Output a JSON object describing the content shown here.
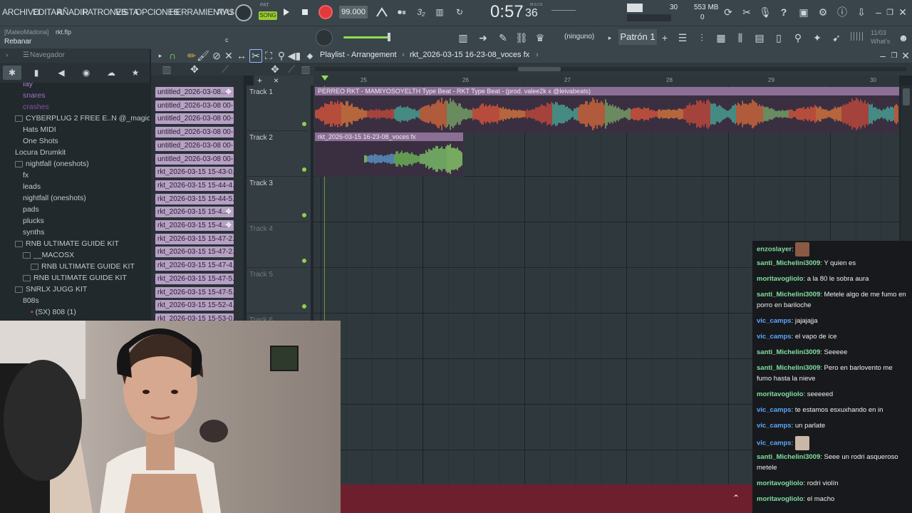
{
  "menu": [
    "ARCHIVO",
    "EDITAR",
    "AÑADIR",
    "PATRONES",
    "VISTA",
    "OPCIONES",
    "HERRAMIENTAS",
    "AYU"
  ],
  "transport": {
    "mode": "SONG",
    "pat_label": "PAT",
    "tempo": "99.000",
    "time": "0:57",
    "time_sub": "36",
    "time_unit": "M:S:CS",
    "cpu": "30",
    "ram": "553 MB",
    "voices": "0"
  },
  "project": {
    "user": "[MateoMadona]",
    "file": "rkt.flp",
    "tool_hint": "Rebanar",
    "snap": "c"
  },
  "toolbar2": {
    "channel": "(ninguno)",
    "pattern": "Patrón 1",
    "news_date": "11/03",
    "news_text": "What's"
  },
  "browser": {
    "title": "Navegador",
    "items": [
      {
        "label": "fay",
        "indent": 2,
        "folder": false,
        "color": "#b07fd0"
      },
      {
        "label": "snares",
        "indent": 2,
        "folder": false,
        "color": "#a070c8"
      },
      {
        "label": "crashes",
        "indent": 2,
        "folder": false,
        "color": "#8050a8"
      },
      {
        "label": "CYBERPLUG 2 FREE E..N @_magicalsounds",
        "indent": 1,
        "folder": true,
        "color": "#bfc8cc"
      },
      {
        "label": "Hats MIDI",
        "indent": 2,
        "folder": false,
        "color": "#bfc8cc"
      },
      {
        "label": "One Shots",
        "indent": 2,
        "folder": false,
        "color": "#bfc8cc"
      },
      {
        "label": "Locura Drumkit",
        "indent": 1,
        "folder": false,
        "color": "#bfc8cc"
      },
      {
        "label": "nightfall (oneshots)",
        "indent": 1,
        "folder": true,
        "color": "#bfc8cc"
      },
      {
        "label": "fx",
        "indent": 2,
        "folder": false,
        "color": "#bfc8cc"
      },
      {
        "label": "leads",
        "indent": 2,
        "folder": false,
        "color": "#bfc8cc"
      },
      {
        "label": "nightfall (oneshots)",
        "indent": 2,
        "folder": false,
        "color": "#bfc8cc"
      },
      {
        "label": "pads",
        "indent": 2,
        "folder": false,
        "color": "#bfc8cc"
      },
      {
        "label": "plucks",
        "indent": 2,
        "folder": false,
        "color": "#bfc8cc"
      },
      {
        "label": "synths",
        "indent": 2,
        "folder": false,
        "color": "#bfc8cc"
      },
      {
        "label": "RNB ULTIMATE GUIDE KIT",
        "indent": 1,
        "folder": true,
        "color": "#bfc8cc"
      },
      {
        "label": "__MACOSX",
        "indent": 2,
        "folder": true,
        "color": "#bfc8cc"
      },
      {
        "label": "RNB ULTIMATE GUIDE KIT",
        "indent": 3,
        "folder": true,
        "color": "#bfc8cc"
      },
      {
        "label": "RNB ULTIMATE GUIDE KIT",
        "indent": 2,
        "folder": true,
        "color": "#bfc8cc"
      },
      {
        "label": "SNRLX JUGG KIT",
        "indent": 1,
        "folder": true,
        "color": "#bfc8cc"
      },
      {
        "label": "808s",
        "indent": 2,
        "folder": false,
        "color": "#bfc8cc"
      },
      {
        "label": "(SX) 808 (1)",
        "indent": 3,
        "folder": false,
        "color": "#bfc8cc"
      }
    ]
  },
  "clips": [
    "untitled_2026-03-08...",
    "untitled_2026-03-08 00-...",
    "untitled_2026-03-08 00-...",
    "untitled_2026-03-08 00-...",
    "untitled_2026-03-08 00-...",
    "untitled_2026-03-08 00-...",
    "rkt_2026-03-15 15-43-0...",
    "rkt_2026-03-15 15-44-4...",
    "rkt_2026-03-15 15-44-5...",
    "rkt_2026-03-15 15-4...",
    "rkt_2026-03-15 15-4...",
    "rkt_2026-03-15 15-47-2...",
    "rkt_2026-03-15 15-47-2...",
    "rkt_2026-03-15 15-47-4...",
    "rkt_2026-03-15 15-47-5...",
    "rkt_2026-03-15 15-47-5...",
    "rkt_2026-03-15 15-52-4...",
    "rkt_2026-03-15 15-53-0..."
  ],
  "playlist": {
    "title": "Playlist - Arrangement",
    "breadcrumb_sep": "›",
    "current_clip": "rkt_2026-03-15 16-23-08_voces fx",
    "ruler": [
      "25",
      "26",
      "27",
      "28",
      "29",
      "30"
    ],
    "tracks": [
      "Track 1",
      "Track 2",
      "Track 3",
      "Track 4",
      "Track 5",
      "Track 6"
    ],
    "audio_clips": [
      {
        "name": "PERREO RKT - MAMIYOSOYELTH Type Beat - RKT Type Beat - (prod. valee2k x @leivabeats)",
        "track": 1
      },
      {
        "name": "rkt_2026-03-15 16-23-08_voces fx",
        "track": 2
      }
    ]
  },
  "chat": [
    {
      "user": "enzoslayer",
      "color": "#7fe0a0",
      "text": "",
      "emote": "face"
    },
    {
      "user": "santi_Michelini3009",
      "color": "#7fe0a0",
      "text": "Y quien es"
    },
    {
      "user": "moritavogliolo",
      "color": "#7fe0a0",
      "text": "a la 80 le sobra aura"
    },
    {
      "user": "santi_Michelini3009",
      "color": "#7fe0a0",
      "text": "Metele algo de me fumo en porro en bariloche"
    },
    {
      "user": "vic_camps",
      "color": "#5aa8ff",
      "text": "jajajajja"
    },
    {
      "user": "vic_camps",
      "color": "#5aa8ff",
      "text": "el vapo de ice"
    },
    {
      "user": "santi_Michelini3009",
      "color": "#7fe0a0",
      "text": "Seeeee"
    },
    {
      "user": "santi_Michelini3009",
      "color": "#7fe0a0",
      "text": "Pero en barlovento me fumo hasta la nieve"
    },
    {
      "user": "moritavogliolo",
      "color": "#7fe0a0",
      "text": "seeeeed"
    },
    {
      "user": "vic_camps",
      "color": "#5aa8ff",
      "text": "te estamos esxuxhando en in"
    },
    {
      "user": "vic_camps",
      "color": "#5aa8ff",
      "text": "un parlate"
    },
    {
      "user": "vic_camps",
      "color": "#5aa8ff",
      "text": "",
      "emote": "cat"
    },
    {
      "user": "santi_Michelini3009",
      "color": "#7fe0a0",
      "text": "Seee un rodri asqueroso metele"
    },
    {
      "user": "moritavogliolo",
      "color": "#7fe0a0",
      "text": "rodri violín"
    },
    {
      "user": "moritavogliolo",
      "color": "#7fe0a0",
      "text": "el macho"
    }
  ],
  "icons": [
    "record-icon",
    "play-icon",
    "stop-icon",
    "metronome-icon",
    "mixer-icon",
    "piano-roll-icon",
    "channel-rack-icon",
    "browser-icon",
    "plugin-icon",
    "search-icon",
    "magnet-icon",
    "pencil-icon",
    "brush-icon",
    "delete-icon",
    "mute-icon",
    "slice-icon",
    "select-icon",
    "zoom-icon",
    "speaker-icon",
    "help-icon",
    "save-icon",
    "settings-icon",
    "download-icon"
  ]
}
